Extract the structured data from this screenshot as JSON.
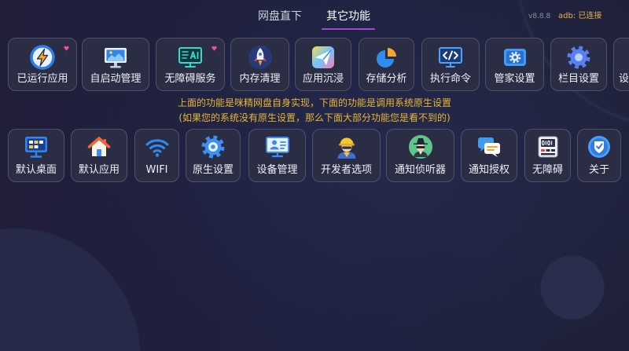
{
  "header": {
    "tabs": [
      {
        "label": "网盘直下",
        "active": false
      },
      {
        "label": "其它功能",
        "active": true
      }
    ],
    "version": "v8.8.8",
    "adb_status": "adb: 已连接"
  },
  "colors": {
    "tab_underline": "#a545d6",
    "notice_text": "#e8b635",
    "adb_status": "#e6b44c",
    "tile_border": "#4f516b",
    "tile_fill": "#2b2d45",
    "background": "#1f2139",
    "badge": "#f04f9a"
  },
  "self_features": [
    {
      "label": "已运行应用",
      "icon": "lightning-icon",
      "badge": true
    },
    {
      "label": "自启动管理",
      "icon": "monitor-icon"
    },
    {
      "label": "无障碍服务",
      "icon": "ai-screen-icon",
      "badge": true
    },
    {
      "label": "内存清理",
      "icon": "rocket-icon"
    },
    {
      "label": "应用沉浸",
      "icon": "paper-plane-icon"
    },
    {
      "label": "存储分析",
      "icon": "pie-chart-icon"
    },
    {
      "label": "执行命令",
      "icon": "code-terminal-icon"
    },
    {
      "label": "管家设置",
      "icon": "settings-panel-icon"
    },
    {
      "label": "栏目设置",
      "icon": "gear-icon"
    },
    {
      "label": "设",
      "partial": true
    }
  ],
  "notice": {
    "line1": "上面的功能是咪精网盘自身实现，下面的功能是调用系统原生设置",
    "line2": "(如果您的系统没有原生设置，那么下面大部分功能您是看不到的)"
  },
  "system_settings": [
    {
      "label": "默认桌面",
      "icon": "desktop-icon"
    },
    {
      "label": "默认应用",
      "icon": "home-icon"
    },
    {
      "label": "WIFI",
      "icon": "wifi-icon"
    },
    {
      "label": "原生设置",
      "icon": "system-gear-icon"
    },
    {
      "label": "设备管理",
      "icon": "device-manager-icon"
    },
    {
      "label": "开发者选项",
      "icon": "developer-icon"
    },
    {
      "label": "通知侦听器",
      "icon": "spy-icon"
    },
    {
      "label": "通知授权",
      "icon": "chat-bubbles-icon"
    },
    {
      "label": "无障碍",
      "icon": "binary-device-icon"
    },
    {
      "label": "关于",
      "icon": "about-icon"
    }
  ]
}
